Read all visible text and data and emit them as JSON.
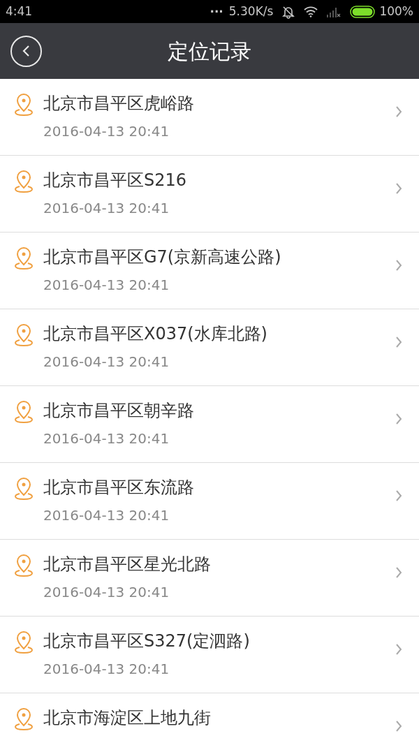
{
  "status_bar": {
    "time": "4:41",
    "dots": "...",
    "speed": "5.30K/s",
    "battery": "100%"
  },
  "header": {
    "title": "定位记录"
  },
  "records": [
    {
      "address": "北京市昌平区虎峪路",
      "time": "2016-04-13 20:41"
    },
    {
      "address": "北京市昌平区S216",
      "time": "2016-04-13 20:41"
    },
    {
      "address": "北京市昌平区G7(京新高速公路)",
      "time": "2016-04-13 20:41"
    },
    {
      "address": "北京市昌平区X037(水库北路)",
      "time": "2016-04-13 20:41"
    },
    {
      "address": "北京市昌平区朝辛路",
      "time": "2016-04-13 20:41"
    },
    {
      "address": "北京市昌平区东流路",
      "time": "2016-04-13 20:41"
    },
    {
      "address": "北京市昌平区星光北路",
      "time": "2016-04-13 20:41"
    },
    {
      "address": "北京市昌平区S327(定泗路)",
      "time": "2016-04-13 20:41"
    },
    {
      "address": "北京市海淀区上地九街"
    }
  ]
}
